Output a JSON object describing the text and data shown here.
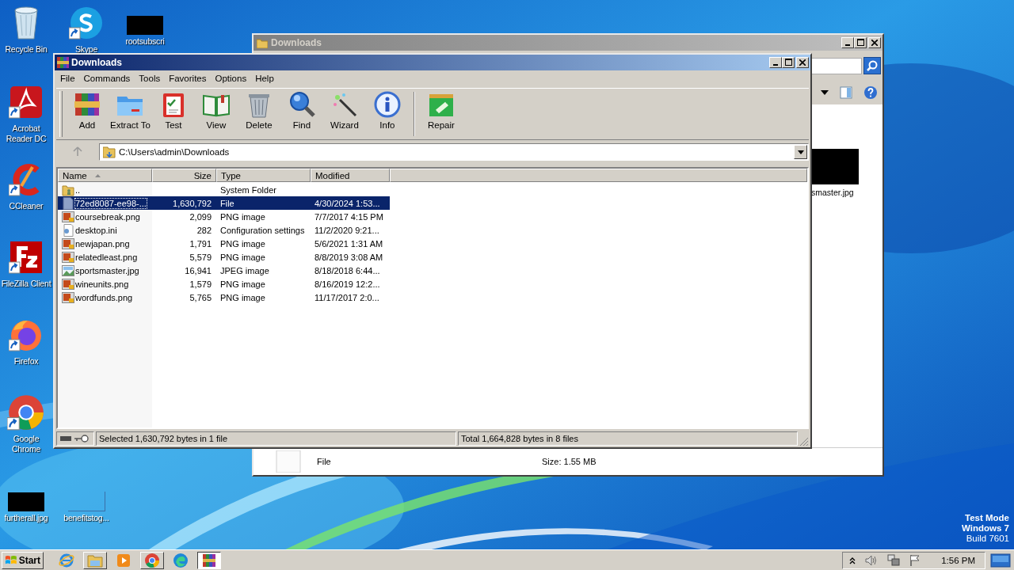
{
  "desktop": {
    "icons": [
      {
        "label": "Recycle Bin",
        "kind": "recycle",
        "shortcut": false
      },
      {
        "label": "Skype",
        "kind": "skype",
        "shortcut": true
      },
      {
        "label": "rootsubscri",
        "kind": "thumbnail",
        "shortcut": false
      },
      {
        "label": "Acrobat Reader DC",
        "kind": "acrobat",
        "shortcut": true
      },
      {
        "label": "CCleaner",
        "kind": "ccleaner",
        "shortcut": true
      },
      {
        "label": "FileZilla Client",
        "kind": "filezilla",
        "shortcut": true
      },
      {
        "label": "Firefox",
        "kind": "firefox",
        "shortcut": true
      },
      {
        "label": "Google Chrome",
        "kind": "chrome",
        "shortcut": true
      },
      {
        "label": "furtherall.jpg",
        "kind": "thumbnail",
        "shortcut": false
      },
      {
        "label": "benefitstog...",
        "kind": "blank",
        "shortcut": false
      }
    ]
  },
  "explorer_window": {
    "title": "Downloads",
    "thumbnail_label": "smaster.jpg",
    "details": {
      "type": "File",
      "size": "Size: 1.55 MB"
    }
  },
  "winrar_window": {
    "title": "Downloads",
    "menu": [
      "File",
      "Commands",
      "Tools",
      "Favorites",
      "Options",
      "Help"
    ],
    "toolbar": [
      {
        "label": "Add",
        "kind": "add"
      },
      {
        "label": "Extract To",
        "kind": "extract"
      },
      {
        "label": "Test",
        "kind": "test"
      },
      {
        "label": "View",
        "kind": "view"
      },
      {
        "label": "Delete",
        "kind": "delete"
      },
      {
        "label": "Find",
        "kind": "find"
      },
      {
        "label": "Wizard",
        "kind": "wizard"
      },
      {
        "label": "Info",
        "kind": "info"
      },
      {
        "label": "Repair",
        "kind": "repair"
      }
    ],
    "address": "C:\\Users\\admin\\Downloads",
    "columns": [
      {
        "label": "Name",
        "sorted": true
      },
      {
        "label": "Size",
        "sorted": false
      },
      {
        "label": "Type",
        "sorted": false
      },
      {
        "label": "Modified",
        "sorted": false
      }
    ],
    "rows": [
      {
        "name": "..",
        "size": "",
        "type": "System Folder",
        "modified": "",
        "kind": "up",
        "selected": false
      },
      {
        "name": "72ed8087-ee98-...",
        "size": "1,630,792",
        "type": "File",
        "modified": "4/30/2024 1:53...",
        "kind": "file",
        "selected": true
      },
      {
        "name": "coursebreak.png",
        "size": "2,099",
        "type": "PNG image",
        "modified": "7/7/2017 4:15 PM",
        "kind": "png",
        "selected": false
      },
      {
        "name": "desktop.ini",
        "size": "282",
        "type": "Configuration settings",
        "modified": "11/2/2020 9:21...",
        "kind": "ini",
        "selected": false
      },
      {
        "name": "newjapan.png",
        "size": "1,791",
        "type": "PNG image",
        "modified": "5/6/2021 1:31 AM",
        "kind": "png",
        "selected": false
      },
      {
        "name": "relatedleast.png",
        "size": "5,579",
        "type": "PNG image",
        "modified": "8/8/2019 3:08 AM",
        "kind": "png",
        "selected": false
      },
      {
        "name": "sportsmaster.jpg",
        "size": "16,941",
        "type": "JPEG image",
        "modified": "8/18/2018 6:44...",
        "kind": "jpg",
        "selected": false
      },
      {
        "name": "wineunits.png",
        "size": "1,579",
        "type": "PNG image",
        "modified": "8/16/2019 12:2...",
        "kind": "png",
        "selected": false
      },
      {
        "name": "wordfunds.png",
        "size": "5,765",
        "type": "PNG image",
        "modified": "11/17/2017 2:0...",
        "kind": "png",
        "selected": false
      }
    ],
    "status": {
      "selected": "Selected 1,630,792 bytes in 1 file",
      "total": "Total 1,664,828 bytes in 8 files"
    }
  },
  "os_notice": [
    "Test Mode",
    "Windows 7",
    "Build 7601"
  ],
  "taskbar": {
    "start": "Start",
    "apps": [
      {
        "kind": "ie",
        "running": false,
        "active": false
      },
      {
        "kind": "explorer",
        "running": true,
        "active": false
      },
      {
        "kind": "media",
        "running": false,
        "active": false
      },
      {
        "kind": "chrome",
        "running": true,
        "active": false
      },
      {
        "kind": "edge",
        "running": false,
        "active": false
      },
      {
        "kind": "winrar",
        "running": true,
        "active": true
      }
    ],
    "clock": "1:56 PM"
  }
}
